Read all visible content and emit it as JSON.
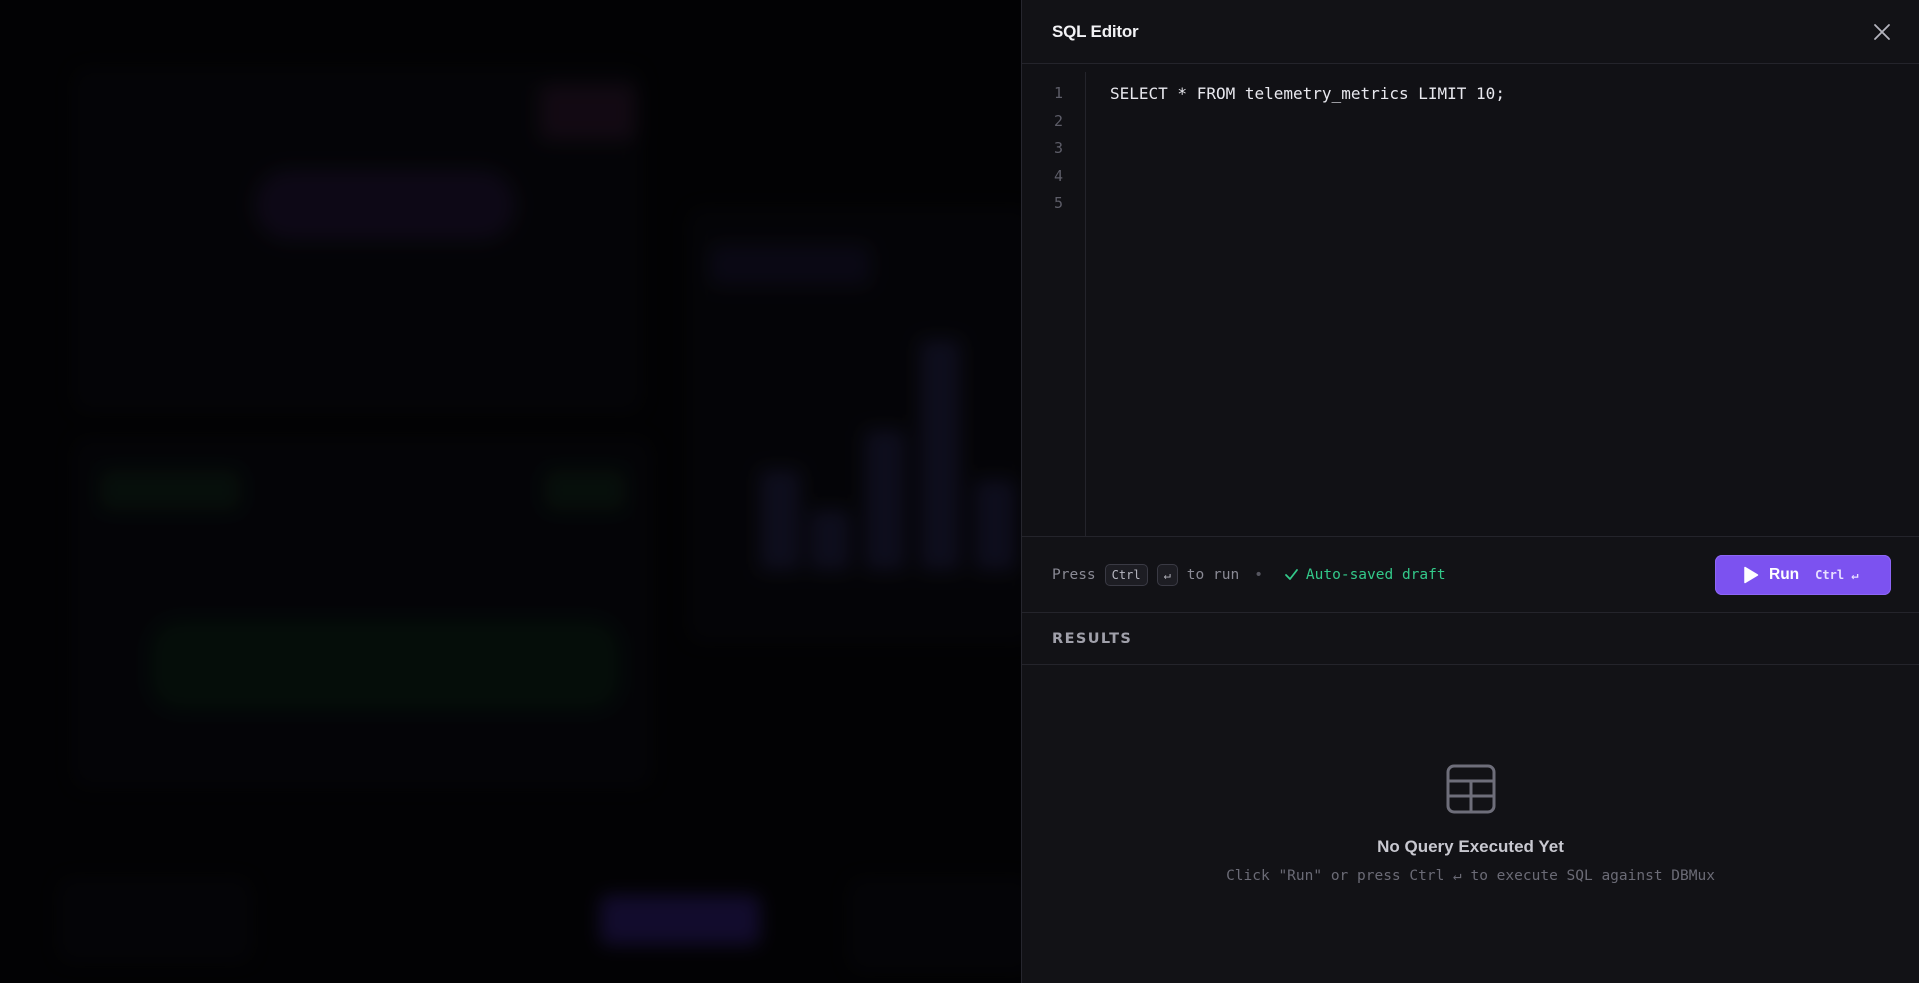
{
  "drawer": {
    "title": "SQL Editor"
  },
  "editor": {
    "line_numbers": [
      "1",
      "2",
      "3",
      "4",
      "5"
    ],
    "lines": [
      "SELECT * FROM telemetry_metrics LIMIT 10;",
      "",
      "",
      "",
      ""
    ]
  },
  "run_bar": {
    "hint_prefix": "Press",
    "key_ctrl": "Ctrl",
    "key_enter": "↵",
    "hint_suffix": "to run",
    "separator": "•",
    "saved_status": "Auto-saved draft",
    "run_label": "Run",
    "run_shortcut": "Ctrl ↵"
  },
  "results": {
    "title": "RESULTS",
    "empty_title": "No Query Executed Yet",
    "empty_subtitle": "Click \"Run\" or press Ctrl ↵ to execute SQL against DBMux"
  },
  "colors": {
    "accent": "#7c52f0",
    "success": "#33c98a",
    "panel_bg": "#121216"
  },
  "icons": {
    "close": "close-icon",
    "check": "check-icon",
    "play": "play-icon",
    "table": "table-grid-icon"
  }
}
